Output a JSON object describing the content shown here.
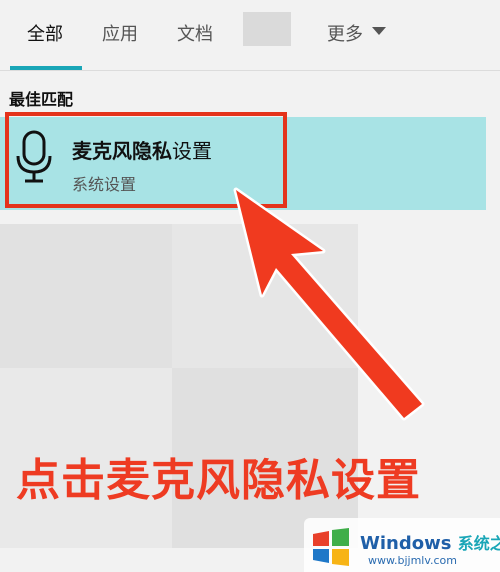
{
  "tabs": [
    {
      "label": "全部",
      "active": true
    },
    {
      "label": "应用",
      "active": false
    },
    {
      "label": "文档",
      "active": false
    }
  ],
  "more_label": "更多",
  "section_title": "最佳匹配",
  "best_match": {
    "title_bold": "麦克风隐私",
    "title_rest": "设置",
    "subtitle": "系统设置",
    "icon": "microphone-icon"
  },
  "caption": "点击麦克风隐私设置",
  "watermark": {
    "brand": "Windows",
    "site_name": "系统之家",
    "url": "www.bjjmlv.com"
  },
  "colors": {
    "accent": "#1aa6b7",
    "highlight_bg": "#a8e3e5",
    "annotation_red": "#e4331b"
  }
}
